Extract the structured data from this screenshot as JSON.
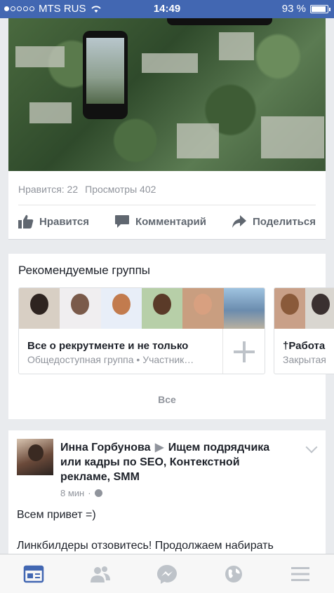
{
  "status_bar": {
    "carrier": "MTS RUS",
    "time": "14:49",
    "battery": "93 %",
    "battery_level": 0.93
  },
  "post_top": {
    "likes": "Нравится: 22",
    "views": "Просмотры 402",
    "actions": {
      "like": "Нравится",
      "comment": "Комментарий",
      "share": "Поделиться"
    }
  },
  "groups": {
    "title": "Рекомендуемые группы",
    "items": [
      {
        "name": "Все о рекрутменте и не только",
        "subtitle": "Общедоступная группа • Участник…"
      },
      {
        "name": "†Работа",
        "subtitle": "Закрытая"
      }
    ],
    "see_all": "Все"
  },
  "post": {
    "author": "Инна Горбунова",
    "target": "Ищем подрядчика или кадры по SEO, Контекстной рекламе, SMM",
    "time": "8 мин",
    "line1": "Всем привет =)",
    "line2": "Линкбилдеры отзовитесь! Продолжаем набирать"
  },
  "tabs": [
    "news-feed-icon",
    "friends-icon",
    "messenger-icon",
    "notifications-globe-icon",
    "menu-icon"
  ],
  "colors": {
    "brand": "#4267b2",
    "active_tab": "#4267b2",
    "inactive_tab": "#bec3c9"
  }
}
